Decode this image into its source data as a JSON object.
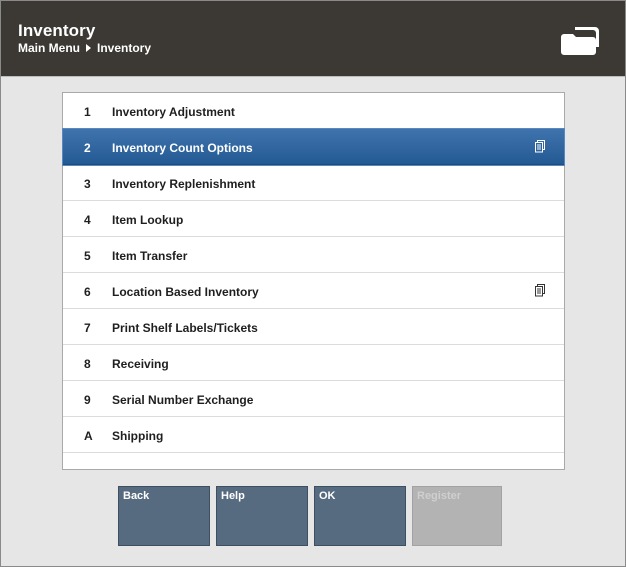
{
  "header": {
    "title": "Inventory",
    "breadcrumb": [
      "Main Menu",
      "Inventory"
    ]
  },
  "menu": {
    "items": [
      {
        "key": "1",
        "label": "Inventory Adjustment",
        "selected": false,
        "has_submenu_icon": false
      },
      {
        "key": "2",
        "label": "Inventory Count Options",
        "selected": true,
        "has_submenu_icon": true
      },
      {
        "key": "3",
        "label": "Inventory Replenishment",
        "selected": false,
        "has_submenu_icon": false
      },
      {
        "key": "4",
        "label": "Item Lookup",
        "selected": false,
        "has_submenu_icon": false
      },
      {
        "key": "5",
        "label": "Item Transfer",
        "selected": false,
        "has_submenu_icon": false
      },
      {
        "key": "6",
        "label": "Location Based Inventory",
        "selected": false,
        "has_submenu_icon": true
      },
      {
        "key": "7",
        "label": "Print Shelf Labels/Tickets",
        "selected": false,
        "has_submenu_icon": false
      },
      {
        "key": "8",
        "label": "Receiving",
        "selected": false,
        "has_submenu_icon": false
      },
      {
        "key": "9",
        "label": "Serial Number Exchange",
        "selected": false,
        "has_submenu_icon": false
      },
      {
        "key": "A",
        "label": "Shipping",
        "selected": false,
        "has_submenu_icon": false
      }
    ]
  },
  "buttons": [
    {
      "label": "Back",
      "enabled": true
    },
    {
      "label": "Help",
      "enabled": true
    },
    {
      "label": "OK",
      "enabled": true
    },
    {
      "label": "Register",
      "enabled": false
    }
  ],
  "colors": {
    "header_bg": "#3c3834",
    "selected_row": "#2f639c",
    "button_bg": "#566b80",
    "button_disabled": "#b3b3b3"
  }
}
